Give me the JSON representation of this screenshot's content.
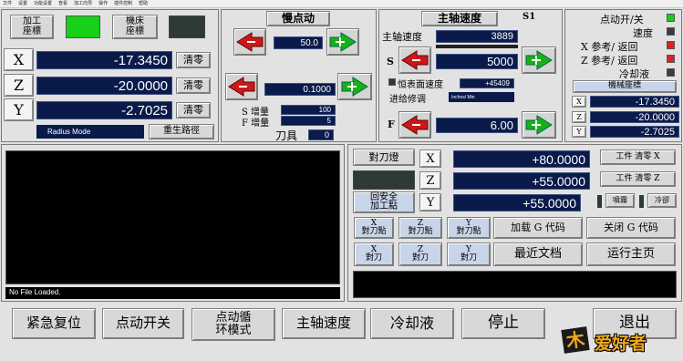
{
  "menubar": [
    "文件",
    "设置",
    "功能设置",
    "查看",
    "加工向导",
    "操作",
    "插件控制",
    "帮助"
  ],
  "coords": {
    "work_coords_label": "加工\n座標",
    "machine_coords_label": "機床\n座標",
    "x": {
      "label": "X",
      "value": "-17.3450",
      "zero": "清零"
    },
    "z": {
      "label": "Z",
      "value": "-20.0000",
      "zero": "清零"
    },
    "y": {
      "label": "Y",
      "value": "-2.7025",
      "zero": "清零"
    },
    "mode": "Radius Mode",
    "regen": "重生路徑"
  },
  "jog": {
    "title": "慢点动",
    "rate1": "50.0",
    "rate2": "0.1000",
    "s_incr_label": "S 增量",
    "s_incr_value": "100",
    "f_incr_label": "F 增量",
    "f_incr_value": "5",
    "tool_label": "刀具",
    "tool_value": "0"
  },
  "spindle": {
    "title": "主轴速度",
    "s1": "S1",
    "speed_label": "主轴速度",
    "speed_value": "3889",
    "s_label": "S",
    "s_value": "5000",
    "css_label": "恒表面速度",
    "css_value": "+45409",
    "feed_override_label": "进给修调",
    "feed_units": "Inches/ Min",
    "f_label": "F",
    "f_value": "6.00"
  },
  "status": {
    "jog_toggle": "点动开/关",
    "speed": "速度",
    "x_ref": "X 参考/ 返回",
    "z_ref": "Z 参考/ 返回",
    "coolant": "冷却液",
    "machine_coords": "機械座標",
    "mx": {
      "label": "X",
      "value": "-17.3450"
    },
    "mz": {
      "label": "Z",
      "value": "-20.0000"
    },
    "my": {
      "label": "Y",
      "value": "-2.7025"
    },
    "colors": {
      "on": "#18d018",
      "alarm": "#e02020",
      "off": "#3a3a3a"
    }
  },
  "gcode": {
    "status": "No File Loaded."
  },
  "touch": {
    "tool_light": "對刀燈",
    "x_label": "X",
    "z_label": "Z",
    "y_label": "Y",
    "x_val": "+80.0000",
    "z_val": "+55.0000",
    "y_val": "+55.0000",
    "safe_btn": "回安全\n加工點",
    "work_zero_x": "工件 清零 X",
    "work_zero_z": "工件 清零 Z",
    "spray": "噴霧",
    "coolant": "冷卻",
    "xp": "X\n對刀點",
    "zp": "Z\n對刀點",
    "yp": "Y\n對刀點",
    "xt": "X\n對刀",
    "zt": "Z\n對刀",
    "yt": "Y\n對刀",
    "load_gcode": "加载 G 代码",
    "close_gcode": "关闭 G 代码",
    "recent": "最近文档",
    "run_home": "运行主页"
  },
  "bottom": {
    "estop": "紧急复位",
    "jog": "点动开关",
    "jog_cycle": "点动循\n环模式",
    "spindle": "主轴速度",
    "coolant": "冷却液",
    "stop": "停止",
    "exit": "退出",
    "logo": "爱好者"
  }
}
